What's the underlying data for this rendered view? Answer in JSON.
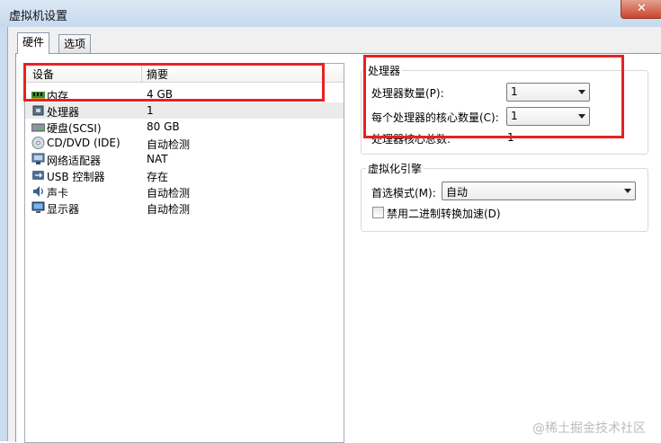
{
  "window": {
    "title": "虚拟机设置",
    "close_glyph": "✕"
  },
  "tabs": [
    {
      "label": "硬件",
      "active": true
    },
    {
      "label": "选项",
      "active": false
    }
  ],
  "device_list": {
    "columns": {
      "device": "设备",
      "summary": "摘要"
    },
    "rows": [
      {
        "name": "内存",
        "summary": "4 GB",
        "icon": "memory-icon"
      },
      {
        "name": "处理器",
        "summary": "1",
        "icon": "processor-icon"
      },
      {
        "name": "硬盘(SCSI)",
        "summary": "80 GB",
        "icon": "hard-disk-icon"
      },
      {
        "name": "CD/DVD (IDE)",
        "summary": "自动检测",
        "icon": "cd-dvd-icon"
      },
      {
        "name": "网络适配器",
        "summary": "NAT",
        "icon": "network-adapter-icon"
      },
      {
        "name": "USB 控制器",
        "summary": "存在",
        "icon": "usb-icon"
      },
      {
        "name": "声卡",
        "summary": "自动检测",
        "icon": "sound-card-icon"
      },
      {
        "name": "显示器",
        "summary": "自动检测",
        "icon": "display-icon"
      }
    ],
    "selected_index": 1
  },
  "processor": {
    "group_title": "处理器",
    "count_label": "处理器数量(P):",
    "count_value": "1",
    "cores_label": "每个处理器的核心数量(C):",
    "cores_value": "1",
    "total_label": "处理器核心总数:",
    "total_value": "1"
  },
  "virtualization": {
    "group_title": "虚拟化引擎",
    "mode_label": "首选模式(M):",
    "mode_value": "自动",
    "disable_bt_label": "禁用二进制转换加速(D)",
    "disable_bt_checked": false
  },
  "annotation_color": "#e62222",
  "watermark": "@稀土掘金技术社区"
}
